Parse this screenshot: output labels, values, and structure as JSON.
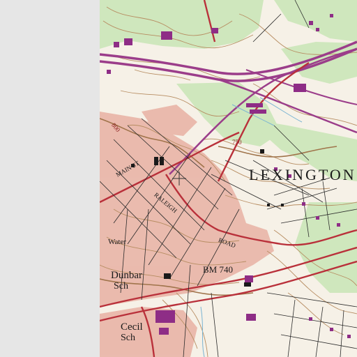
{
  "map": {
    "style": "USGS topographic quadrangle",
    "colors": {
      "background": "#e6e6e6",
      "paper": "#f6f1e7",
      "contour": "#b78d62",
      "urban_tint": "#e8b1a3",
      "woodland": "#cfe7bd",
      "interstate": "#9b3d8a",
      "road_red": "#b9303a",
      "building": "#8e2d86",
      "water": "#7ab4d3",
      "street": "#2a2a2a"
    },
    "labels": {
      "place_name": "LEXINGTON",
      "main_st": "MAIN ST",
      "raleigh_road": "RALEIGH",
      "road": "ROAD",
      "water": "Water",
      "dunbar": "Dunbar",
      "dunbar_sch": "Sch",
      "cecil": "Cecil",
      "cecil_sch": "Sch",
      "benchmark": "BM 740",
      "elev_800": "800",
      "elev_750": "750"
    },
    "crosshair": "center-crosshair"
  }
}
